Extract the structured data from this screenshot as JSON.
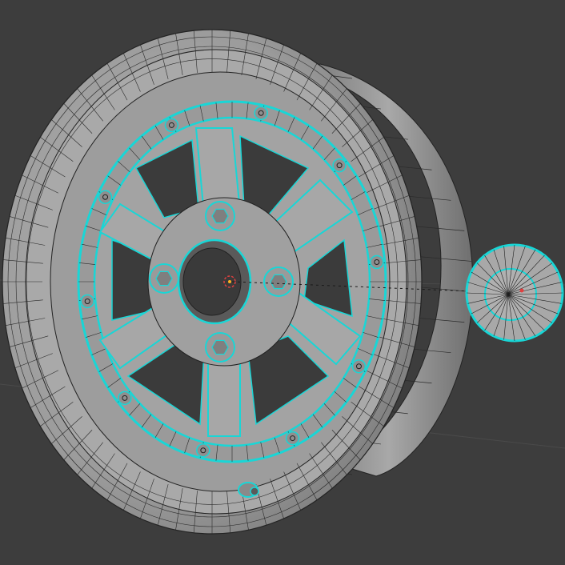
{
  "viewport": {
    "mode": "edit-mode-wireframe-overlay",
    "background_color": "#3d3d3d",
    "mesh_color": "#9a9a9a",
    "wire_color": "#1f1f1f",
    "selection_color": "#19d6d6",
    "origin_marker_color": "#e04040"
  },
  "objects": {
    "wheel": {
      "name_hint": "wheel-rim",
      "spokes": 6,
      "lug_nuts": 4,
      "bolts": 10
    },
    "valve_cap": {
      "name_hint": "valve-stem"
    },
    "side_disc": {
      "name_hint": "separate-disc-object"
    }
  }
}
